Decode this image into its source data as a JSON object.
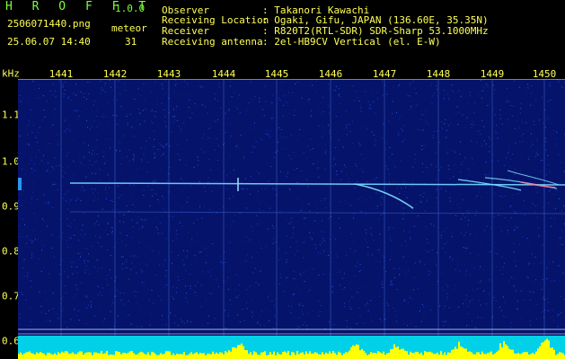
{
  "header": {
    "app_title": "H R O F F T",
    "version": "1.0.0",
    "filename": "2506071440.png",
    "datetime": "25.06.07 14:40",
    "detection_label": "meteor",
    "detection_count": "31",
    "info_labels": [
      "Observer",
      "Receiving Location",
      "Receiver",
      "Receiving antenna"
    ],
    "info_values": [
      ": Takanori Kawachi",
      ": Ogaki, Gifu, JAPAN (136.60E, 35.35N)",
      ": R820T2(RTL-SDR) SDR-Sharp 53.1000MHz",
      ": 2el-HB9CV Vertical (el. E-W)"
    ]
  },
  "axes": {
    "x_ticks": [
      "1441",
      "1442",
      "1443",
      "1444",
      "1445",
      "1446",
      "1447",
      "1448",
      "1449",
      "1450"
    ],
    "y_unit": "kHz",
    "y_ticks": [
      "1.1",
      "1.0",
      "0.9",
      "0.8",
      "0.7",
      "0.6"
    ]
  },
  "colors": {
    "background": "#06136b",
    "trace": "#6fd3ff",
    "level_fill": "#ffff00",
    "level_bg": "#00d0e8",
    "text_yellow": "#ffff55",
    "text_green": "#7cff3f"
  }
}
